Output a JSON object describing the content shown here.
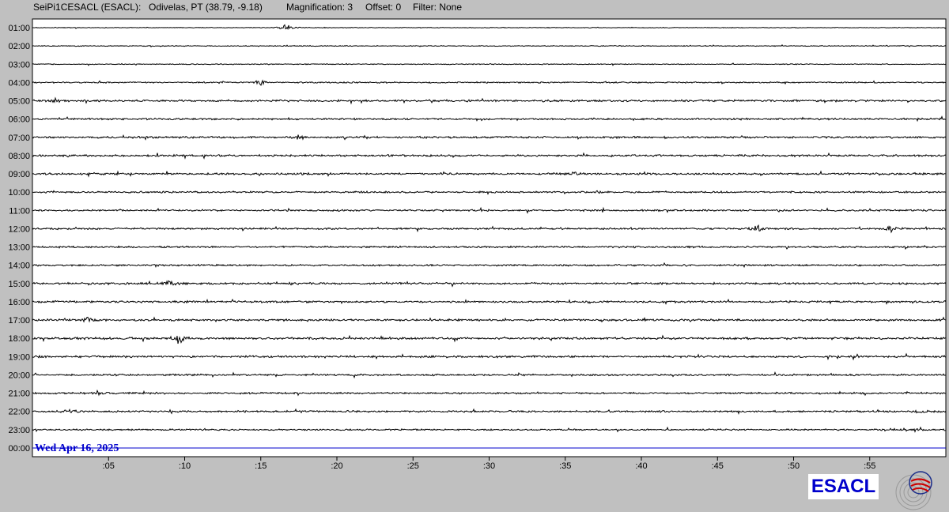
{
  "header": {
    "station": "SeiPi1CESACL (ESACL):",
    "location": "Odivelas, PT (38.79, -9.18)",
    "magnification": "Magnification: 3",
    "offset": "Offset: 0",
    "filter": "Filter: None"
  },
  "chart_data": {
    "type": "line",
    "title": "",
    "y_labels": [
      "01:00",
      "02:00",
      "03:00",
      "04:00",
      "05:00",
      "06:00",
      "07:00",
      "08:00",
      "09:00",
      "10:00",
      "11:00",
      "12:00",
      "13:00",
      "14:00",
      "15:00",
      "16:00",
      "17:00",
      "18:00",
      "19:00",
      "20:00",
      "21:00",
      "22:00",
      "23:00",
      "00:00"
    ],
    "x_labels": [
      ":05",
      ":10",
      ":15",
      ":20",
      ":25",
      ":30",
      ":35",
      ":40",
      ":45",
      ":50",
      ":55"
    ],
    "x_range_minutes": [
      0,
      60
    ],
    "noise_level": [
      0.3,
      0.4,
      0.4,
      0.6,
      0.9,
      0.8,
      0.9,
      0.9,
      0.9,
      0.8,
      0.8,
      0.8,
      0.8,
      0.8,
      0.9,
      0.9,
      0.9,
      1.0,
      0.9,
      0.8,
      0.8,
      0.8,
      0.7,
      0
    ],
    "bursts": [
      {
        "row": 0,
        "minute": 16.7,
        "amp": 6
      },
      {
        "row": 3,
        "minute": 15.0,
        "amp": 3
      },
      {
        "row": 4,
        "minute": 1.5,
        "amp": 3
      },
      {
        "row": 6,
        "minute": 17.5,
        "amp": 4
      },
      {
        "row": 8,
        "minute": 35.7,
        "amp": 3
      },
      {
        "row": 11,
        "minute": 47.6,
        "amp": 5
      },
      {
        "row": 11,
        "minute": 56.4,
        "amp": 4
      },
      {
        "row": 14,
        "minute": 9.0,
        "amp": 4
      },
      {
        "row": 16,
        "minute": 3.6,
        "amp": 3
      },
      {
        "row": 17,
        "minute": 9.6,
        "amp": 6
      },
      {
        "row": 20,
        "minute": 4.3,
        "amp": 3
      },
      {
        "row": 21,
        "minute": 2.5,
        "amp": 3
      },
      {
        "row": 21,
        "minute": 58.2,
        "amp": 3
      },
      {
        "row": 22,
        "minute": 58.0,
        "amp": 3
      }
    ],
    "date_label": "Wed Apr 16, 2025",
    "trace_color": "#000000",
    "current_trace_color": "#0000cc"
  },
  "logo": {
    "text": "ESACL"
  }
}
